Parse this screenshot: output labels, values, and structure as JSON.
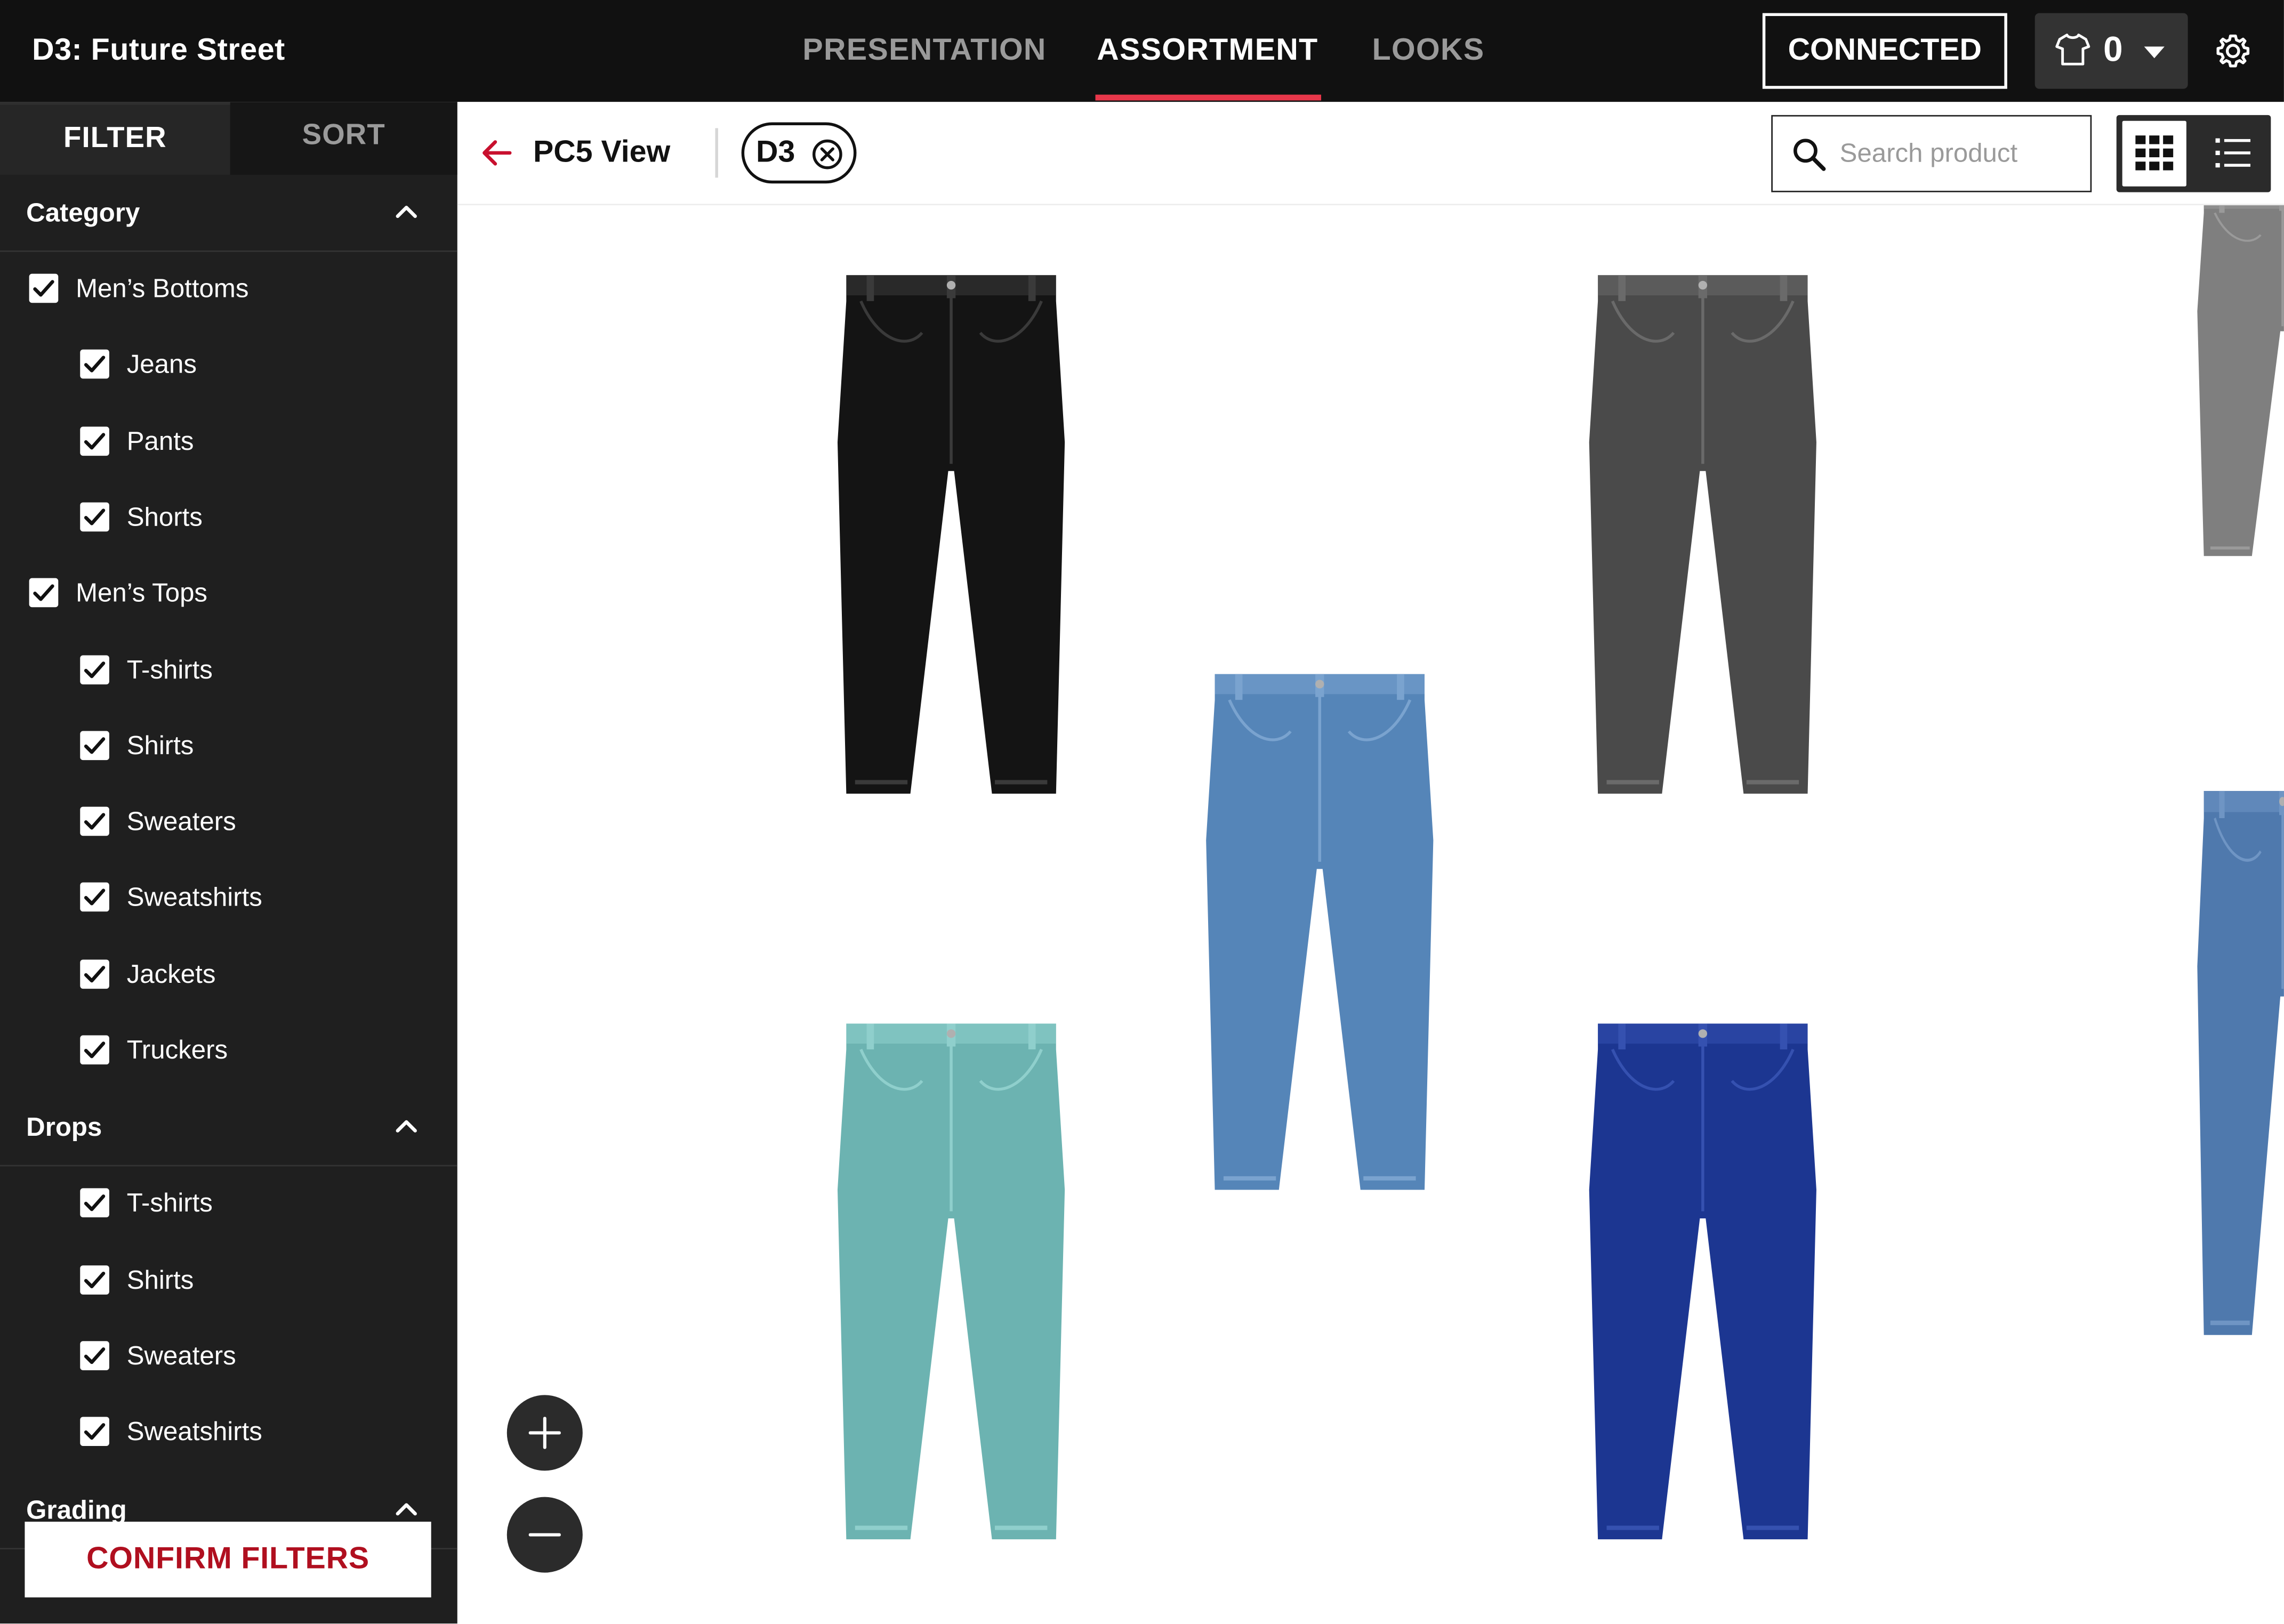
{
  "header": {
    "app_title": "D3: Future Street",
    "nav_tabs": [
      {
        "label": "PRESENTATION",
        "active": false
      },
      {
        "label": "ASSORTMENT",
        "active": true
      },
      {
        "label": "LOOKS",
        "active": false
      }
    ],
    "connection_button": "CONNECTED",
    "cart_count": "0",
    "accent_color": "#e8374a"
  },
  "sidebar": {
    "tabs": {
      "filter": "FILTER",
      "sort": "SORT"
    },
    "sections": [
      {
        "title": "Category",
        "expanded": true,
        "items": [
          {
            "label": "Men’s Bottoms",
            "checked": true,
            "level": 0
          },
          {
            "label": "Jeans",
            "checked": true,
            "level": 1
          },
          {
            "label": "Pants",
            "checked": true,
            "level": 1
          },
          {
            "label": "Shorts",
            "checked": true,
            "level": 1
          },
          {
            "label": "Men’s Tops",
            "checked": true,
            "level": 0
          },
          {
            "label": "T-shirts",
            "checked": true,
            "level": 1
          },
          {
            "label": "Shirts",
            "checked": true,
            "level": 1
          },
          {
            "label": "Sweaters",
            "checked": true,
            "level": 1
          },
          {
            "label": "Sweatshirts",
            "checked": true,
            "level": 1
          },
          {
            "label": "Jackets",
            "checked": true,
            "level": 1
          },
          {
            "label": "Truckers",
            "checked": true,
            "level": 1
          }
        ]
      },
      {
        "title": "Drops",
        "expanded": true,
        "items": [
          {
            "label": "T-shirts",
            "checked": true,
            "level": 1
          },
          {
            "label": "Shirts",
            "checked": true,
            "level": 1
          },
          {
            "label": "Sweaters",
            "checked": true,
            "level": 1
          },
          {
            "label": "Sweatshirts",
            "checked": true,
            "level": 1
          }
        ]
      },
      {
        "title": "Grading",
        "expanded": true,
        "items": []
      }
    ],
    "confirm_button": "CONFIRM FILTERS",
    "confirm_color": "#b00f1f"
  },
  "toolbar": {
    "view_title": "PC5 View",
    "filter_chip": "D3",
    "search_placeholder": "Search product",
    "view_mode": "grid"
  },
  "products": [
    {
      "name": "jeans-black",
      "color": "#141414",
      "stitch": "#3a3a3a"
    },
    {
      "name": "jeans-grey",
      "color": "#4a4a4a",
      "stitch": "#6a6a6a"
    },
    {
      "name": "jeans-mid-blue",
      "color": "#5585b8",
      "stitch": "#7aa3cf"
    },
    {
      "name": "jeans-teal",
      "color": "#6cb3b1",
      "stitch": "#8fcfcc"
    },
    {
      "name": "jeans-royal-blue",
      "color": "#1c3691",
      "stitch": "#3551b0"
    },
    {
      "name": "jeans-grey-partial",
      "color": "#7f7f7f",
      "stitch": "#9a9a9a"
    },
    {
      "name": "jeans-blue-partial",
      "color": "#4f79ad",
      "stitch": "#6f95c4"
    }
  ],
  "icons": {
    "cart": "tshirt-icon",
    "settings": "gear-icon",
    "back": "arrow-left-icon",
    "chip_remove": "close-circle-icon",
    "search": "search-icon",
    "grid_view": "grid-icon",
    "list_view": "list-icon",
    "zoom_in": "plus-icon",
    "zoom_out": "minus-icon"
  }
}
